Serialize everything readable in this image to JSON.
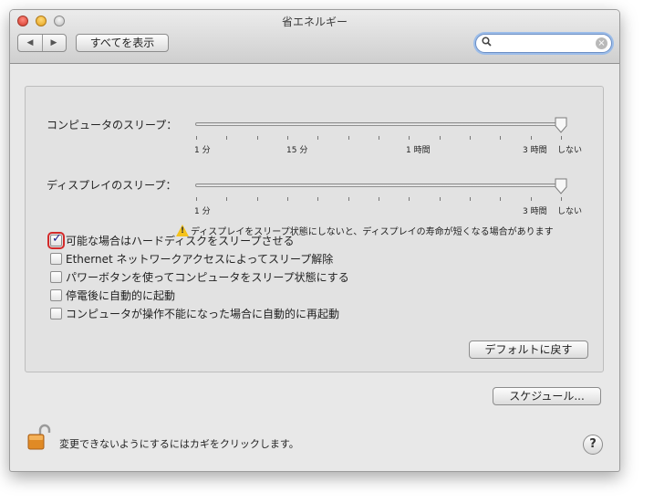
{
  "window": {
    "title": "省エネルギー"
  },
  "toolbar": {
    "back_icon": "◀",
    "forward_icon": "▶",
    "show_all_label": "すべてを表示",
    "search_placeholder": "",
    "search_value": ""
  },
  "computer_sleep": {
    "label": "コンピュータのスリープ：",
    "ticks": [
      "1 分",
      "15 分",
      "1 時間",
      "3 時間",
      "しない"
    ],
    "value": "しない"
  },
  "display_sleep": {
    "label": "ディスプレイのスリープ：",
    "ticks": [
      "1 分",
      "3 時間",
      "しない"
    ],
    "value": "しない"
  },
  "warning": "ディスプレイをスリープ状態にしないと、ディスプレイの寿命が短くなる場合があります",
  "options": [
    {
      "label": "可能な場合はハードディスクをスリープさせる",
      "checked": true
    },
    {
      "label": "Ethernet ネットワークアクセスによってスリープ解除",
      "checked": false
    },
    {
      "label": "パワーボタンを使ってコンピュータをスリープ状態にする",
      "checked": false
    },
    {
      "label": "停電後に自動的に起動",
      "checked": false
    },
    {
      "label": "コンピュータが操作不能になった場合に自動的に再起動",
      "checked": false
    }
  ],
  "buttons": {
    "restore_defaults": "デフォルトに戻す",
    "schedule": "スケジュール..."
  },
  "footer": {
    "lock_text": "変更できないようにするにはカギをクリックします。",
    "help": "?"
  },
  "colors": {
    "highlight": "#d32a2a",
    "accent": "#6d8fc4",
    "warning": "#f4c21b"
  }
}
